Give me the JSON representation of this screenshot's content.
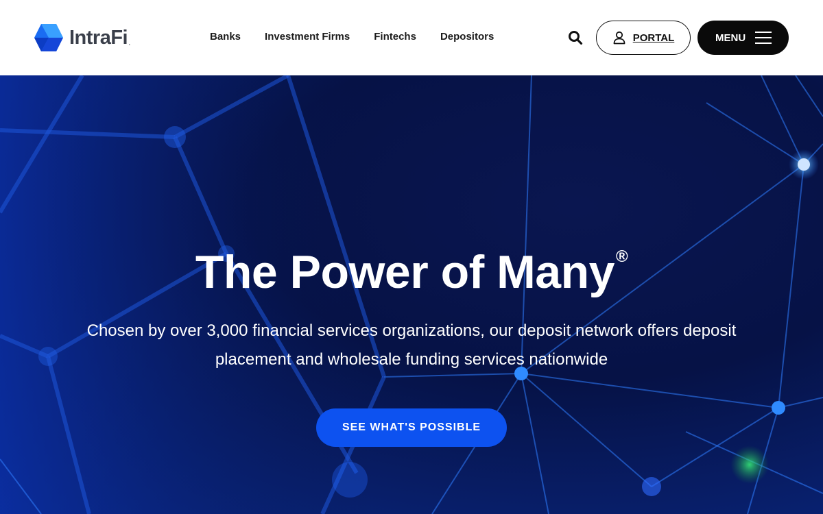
{
  "header": {
    "logo_text": "IntraFi",
    "logo_mark": ".",
    "nav": [
      "Banks",
      "Investment Firms",
      "Fintechs",
      "Depositors"
    ],
    "search_icon": "search-icon",
    "portal_label": "PORTAL",
    "portal_icon": "user-icon",
    "menu_label": "MENU",
    "menu_icon": "hamburger-icon"
  },
  "hero": {
    "title": "The Power of Many",
    "title_mark": "®",
    "subtitle": "Chosen by over 3,000 financial services organizations, our deposit network offers deposit placement and wholesale funding services nationwide",
    "cta_label": "SEE WHAT'S POSSIBLE"
  },
  "colors": {
    "accent": "#0d52f0",
    "hero_background": "#061246",
    "header_background": "#ffffff",
    "menu_button": "#0a0a0a"
  }
}
